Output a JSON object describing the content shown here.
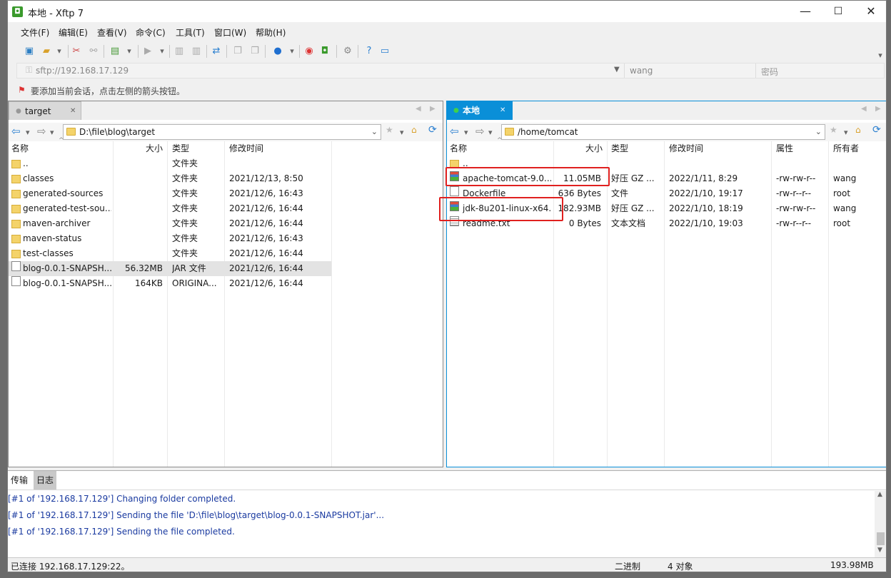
{
  "window": {
    "title": "本地 - Xftp 7",
    "app_icon": "xftp-icon",
    "minimize": "—",
    "maximize": "☐",
    "close": "✕"
  },
  "menu": [
    "文件(F)",
    "编辑(E)",
    "查看(V)",
    "命令(C)",
    "工具(T)",
    "窗口(W)",
    "帮助(H)"
  ],
  "address": {
    "url": "sftp://192.168.17.129",
    "user": "wang",
    "password_placeholder": "密码"
  },
  "hint": "要添加当前会话，点击左侧的箭头按钮。",
  "left_pane": {
    "tab": "target",
    "path": "D:\\file\\blog\\target",
    "columns": [
      "名称",
      "大小",
      "类型",
      "修改时间"
    ],
    "rows": [
      {
        "name": "..",
        "size": "",
        "type": "文件夹",
        "date": "",
        "icon": "folder"
      },
      {
        "name": "classes",
        "size": "",
        "type": "文件夹",
        "date": "2021/12/13, 8:50",
        "icon": "folder"
      },
      {
        "name": "generated-sources",
        "size": "",
        "type": "文件夹",
        "date": "2021/12/6, 16:43",
        "icon": "folder"
      },
      {
        "name": "generated-test-sou...",
        "size": "",
        "type": "文件夹",
        "date": "2021/12/6, 16:44",
        "icon": "folder"
      },
      {
        "name": "maven-archiver",
        "size": "",
        "type": "文件夹",
        "date": "2021/12/6, 16:44",
        "icon": "folder"
      },
      {
        "name": "maven-status",
        "size": "",
        "type": "文件夹",
        "date": "2021/12/6, 16:43",
        "icon": "folder"
      },
      {
        "name": "test-classes",
        "size": "",
        "type": "文件夹",
        "date": "2021/12/6, 16:44",
        "icon": "folder"
      },
      {
        "name": "blog-0.0.1-SNAPSH...",
        "size": "56.32MB",
        "type": "JAR 文件",
        "date": "2021/12/6, 16:44",
        "icon": "file"
      },
      {
        "name": "blog-0.0.1-SNAPSH...",
        "size": "164KB",
        "type": "ORIGINA...",
        "date": "2021/12/6, 16:44",
        "icon": "file"
      }
    ]
  },
  "right_pane": {
    "tab": "本地",
    "path": "/home/tomcat",
    "columns": [
      "名称",
      "大小",
      "类型",
      "修改时间",
      "属性",
      "所有者"
    ],
    "rows": [
      {
        "name": "..",
        "size": "",
        "type": "",
        "date": "",
        "attr": "",
        "owner": "",
        "icon": "folder"
      },
      {
        "name": "apache-tomcat-9.0....",
        "size": "11.05MB",
        "type": "好压 GZ ...",
        "date": "2022/1/11, 8:29",
        "attr": "-rw-rw-r--",
        "owner": "wang",
        "icon": "archive"
      },
      {
        "name": "Dockerfile",
        "size": "636 Bytes",
        "type": "文件",
        "date": "2022/1/10, 19:17",
        "attr": "-rw-r--r--",
        "owner": "root",
        "icon": "file"
      },
      {
        "name": "jdk-8u201-linux-x64...",
        "size": "182.93MB",
        "type": "好压 GZ ...",
        "date": "2022/1/10, 18:19",
        "attr": "-rw-rw-r--",
        "owner": "wang",
        "icon": "archive"
      },
      {
        "name": "readme.txt",
        "size": "0 Bytes",
        "type": "文本文档",
        "date": "2022/1/10, 19:03",
        "attr": "-rw-r--r--",
        "owner": "root",
        "icon": "text"
      }
    ]
  },
  "log": {
    "tabs": [
      "传输",
      "日志"
    ],
    "lines": [
      "[#1 of '192.168.17.129']  Changing folder completed.",
      "[#1 of '192.168.17.129']  Sending the file 'D:\\file\\blog\\target\\blog-0.0.1-SNAPSHOT.jar'...",
      "[#1 of '192.168.17.129']  Sending the file completed."
    ]
  },
  "status": {
    "connection": "已连接 192.168.17.129:22。",
    "mode": "二进制",
    "objects": "4 对象",
    "size": "193.98MB"
  },
  "colors": {
    "accent": "#0a8fd8",
    "highlight": "#e0201f",
    "log_text": "#1a3aa0"
  }
}
